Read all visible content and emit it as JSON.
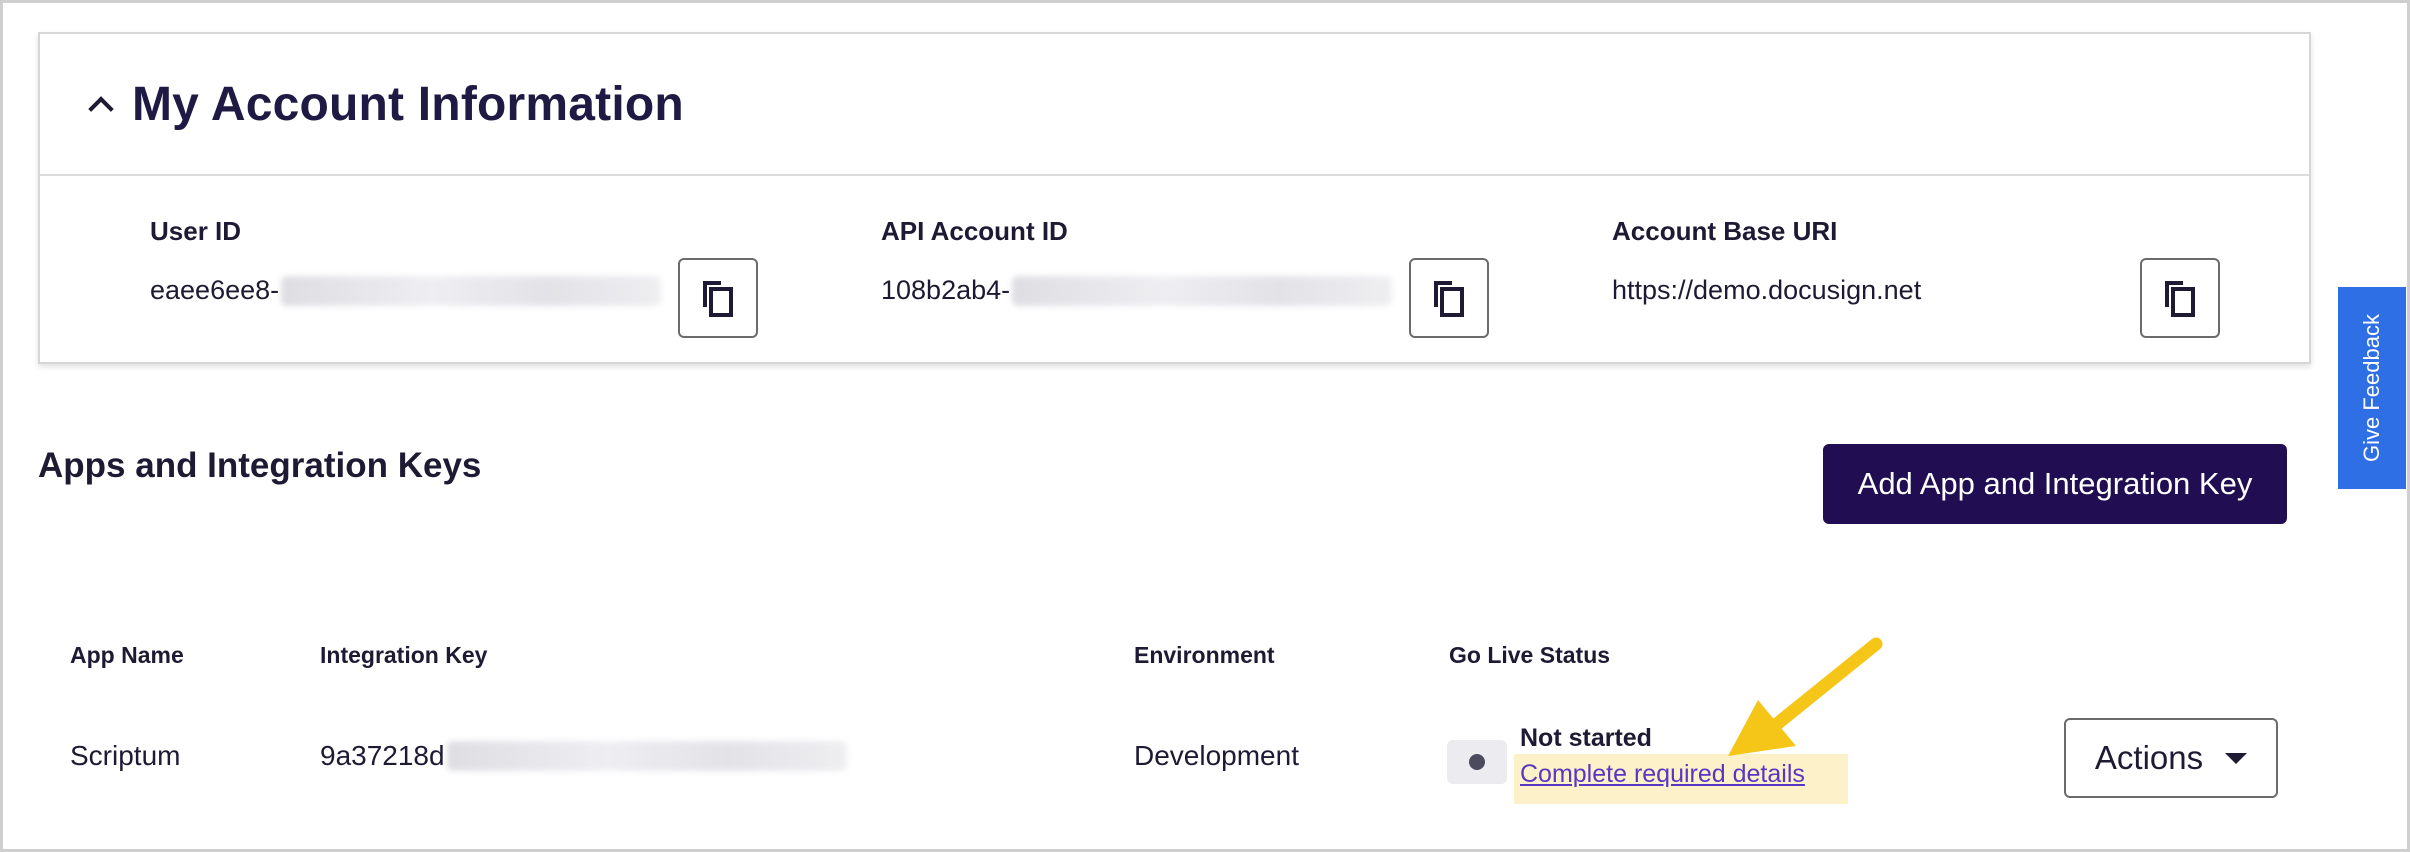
{
  "account": {
    "title": "My Account Information",
    "fields": [
      {
        "label": "User ID",
        "value": "eaee6ee8-"
      },
      {
        "label": "API Account ID",
        "value": "108b2ab4-"
      },
      {
        "label": "Account Base URI",
        "value": "https://demo.docusign.net"
      }
    ]
  },
  "apps": {
    "title": "Apps and Integration Keys",
    "add_button": "Add App and Integration Key",
    "columns": [
      "App Name",
      "Integration Key",
      "Environment",
      "Go Live Status"
    ],
    "rows": [
      {
        "app_name": "Scriptum",
        "integration_key": "9a37218d",
        "environment": "Development",
        "status": "Not started",
        "status_link": "Complete required details",
        "actions_label": "Actions"
      }
    ]
  },
  "feedback": {
    "label": "Give Feedback"
  },
  "colors": {
    "primary_button": "#200d52",
    "feedback_tab": "#2f6fe6",
    "highlight": "#fdf1c9",
    "link": "#5a36c5",
    "annotation_arrow": "#f5c518"
  },
  "icons": [
    "chevron-up-icon",
    "copy-icon",
    "caret-down-icon",
    "arrow-annotation"
  ]
}
